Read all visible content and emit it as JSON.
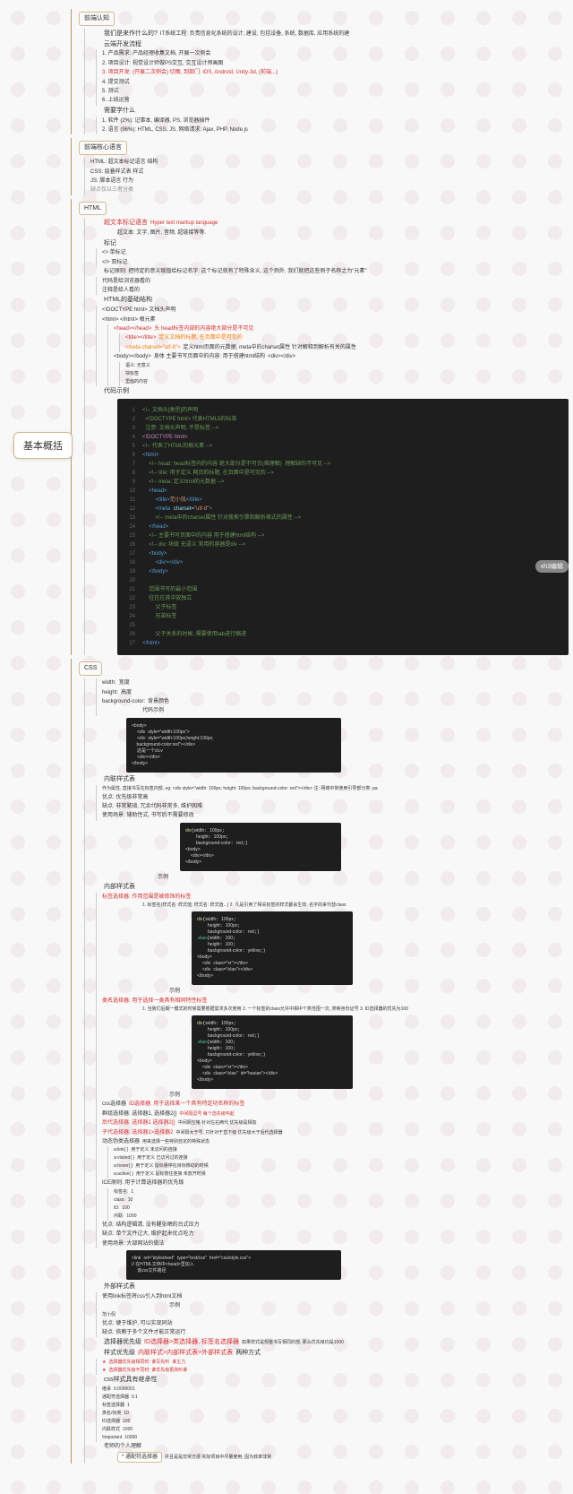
{
  "root": "基本概括",
  "badge": "xh3编辑",
  "s1": {
    "title": "前端认知",
    "q1": "我们是来作什么的?",
    "q1v": "IT系统工程: 负责信息化系统的设计, 建设, 包括设备, 系统, 数据库, 应用系统的建",
    "flow_title": "云端开发流程",
    "flow": [
      "1. 产品需求: 产品经理收集文档, 开展一次例会",
      "2. 项目设计: 视觉设计师做PS交互, 交互设计师画图",
      "3. 项目开发: (开展二次例会) 切图, 到部门: iOS, Android, Unity-3d, (前端...)",
      "4. 提交测试",
      "5. 测试",
      "6. 上线运营"
    ],
    "learn_title": "需要学什么",
    "learn": [
      "1. 软件 (2%): 记事本, 编译器, PS, 浏览器插件",
      "2. 语言 (96%): HTML, CSS, JS, 网络请求: Ajax, PHP, Node.js"
    ]
  },
  "s2": {
    "title": "前端核心语言",
    "items": [
      "HTML: 超文本标记语言    结构",
      "CSS: 层叠样式表    样式",
      "JS: 脚本语言    行为",
      "缺点仅以三者分类"
    ]
  },
  "s3": {
    "title": "HTML",
    "hyper_title": "超文本标记语言",
    "hyper_en": "Hyper text markup language",
    "hyper_desc": "超文本: 文字, 图片, 音频, 超链接等等.",
    "tag_title": "标记",
    "tag_single": "<>    单标记",
    "tag_double": "</>    双标记",
    "tag_rule": "标记原则: 把特定的意义赋值给标记名字: 这个标记就有了特殊含义, 这个例外, 我们就把这些例子名称之为\"元素\"",
    "tag_side1": "代码是给浏览器看的",
    "tag_side2": "注释是给人看的",
    "struct_title": "HTML的基础结构",
    "doctype": "<!DOCTYPE html>    文档头声明",
    "html_tag": "<html> </html>    根元素",
    "head_tag": "<head></head>",
    "head_red": "头    head标签内部的内容绝大部分是不可见",
    "title_tag": "<title></title>",
    "title_desc": "定义文档的标题, 在页面中是可见的",
    "meta_tag": "<meta charset=\"utf-8\">",
    "meta_desc": "定义html页面的元数据, meta中的charset属性 针对解释到解析有关的属性",
    "body_tag": "<body></body>",
    "body_desc": "身体    主要书写页面中的内容: 用于搭建html结构",
    "div_tag": "<div></div>",
    "div_items": [
      "语义: 无意义",
      "块标签",
      "里面的内容"
    ],
    "code_title": "代码示例"
  },
  "code_main": [
    "<!-- 文档头[类型]的声明 -->",
    "<!DOCTYPE html> 代表HTML5的标准",
    "  注意: 文档头声明, 不是标签 -->",
    "<!DOCTYPE html>",
    "<!-- 代表了HTML的根元素 -->",
    "<html>",
    "  <!-- head: head标签内的内容 绝大部分是不可见(难理解)    理解缺的不可见 -->",
    "  <!-- title: 用于定义 网页的标题, 在页面中是可见的 -->",
    "  <!-- meta: 定义html的元数据 -->",
    "  <head>",
    "    <title>范小侃</title>",
    "    <meta charset=\"utf-8\">",
    "    <!-- meta中的charset属性 针对搜索引擎和解析格式的属性 -->",
    "  </head>",
    "  <!-- 主要书写页面中的内容 用于搭建html结构 -->",
    "  <!-- div: 块级 无语义 常用的容器是div -->",
    "  <body>",
    "    <div></div>",
    "  </body>",
    "  范围书写的最小范围",
    "  往往在其中放独立",
    "    父子标签",
    "    兄弟标签",
    "    父子关系的时候, 需要使用tab进行缩进",
    "</html>"
  ],
  "css": {
    "title": "CSS",
    "props": [
      {
        "k": "width:",
        "v": "宽度"
      },
      {
        "k": "height:",
        "v": "高度"
      },
      {
        "k": "background-color:",
        "v": "背景颜色"
      }
    ],
    "inline": {
      "title": "内联样式表",
      "desc": "作为属性, 直接书写在标签内部, eg: <div style=\"width: 100px; height: 100px; background-color: red\"></div>  注: 网络中常使用引导部分类: pa",
      "pros": "优点: 优先级非常高",
      "cons": "缺点: 非常繁琐, 冗余代码非常多, 维护困难",
      "use": "使用场景: 辅助性式, 书写后不需要修改"
    },
    "internal": {
      "title": "内部样式表",
      "sel_title": "css选择器",
      "tag_sel": "标签选择器: 作用范围是被修饰的标签",
      "tag_note": "1. 标签名{样式名: 样式值; 样式名: 样式值...}  2. 凡是引用了相关标签的样式都会生效, 名字的来代替class",
      "class_sel": "类名选择器: 用于选择一类具有相同特性标签",
      "class_note": "1. 当我们后期一模式的时候需要根据需求多次使用  2. 一个标签的class允许中相中个类范围一次, 类映身份证号  3. ID选择器的优先为100",
      "id_sel": "ID选择器: 用于选择某一个具有特定功名称的标签",
      "group_sel": "群组选择器: 选择器1, 选择器2{}",
      "group_note": "中间隔逗号  每个选先级叫起",
      "desc_sel": "后代选择器: 选择器1 选择器2{}",
      "desc_note": "中间隔空格 针对左右两代  优先级是相加",
      "child_sel": "子代选择器: 选择器1>选择器2",
      "child_note": "中间隔大于号, 只针对于直下级  优先级大于后代选择器",
      "pseudo_title": "动态伪类选择器",
      "pseudo_desc": "用来选择一些特别自定的特殊状态",
      "pseudos": [
        {
          "k": "a:link{ }",
          "v": "用于定义 未访问的连接"
        },
        {
          "k": "a:visited{ }",
          "v": "用于定义 已访问过的连接"
        },
        {
          "k": "a:hover{ }",
          "v": "用于定义 鼠标悬停在目标移动的时候"
        },
        {
          "k": "a:active{ }",
          "v": "用于定义 鼠标按住连接 未放开时候"
        }
      ],
      "ice_title": "ICE原则: 用于计算选择器的优先级",
      "ice": [
        {
          "k": "标签名:",
          "v": "1"
        },
        {
          "k": "class:",
          "v": "10"
        },
        {
          "k": "ID:",
          "v": "100"
        },
        {
          "k": "内联:",
          "v": "1000"
        }
      ],
      "int_pros": "优点: 结构逻辑清, 没有醒张晒的台式压力",
      "int_cons": "缺点: 单个文件过大, 维护起来优点吃力",
      "int_use": "使用场景: 大部网站的做法"
    },
    "external": {
      "title": "外部样式表",
      "link": "使用link标签将css引入到html文档",
      "link_code": "<link rel=\"stylesheet\" type=\"text/css\" href=\"css/style.css\">",
      "exam": "范小侃",
      "pros": "优点: 便于维护, 可以实现同站",
      "cons": "缺点: 依赖于多个文件才能正常运行"
    },
    "priority": {
      "title": "选择器优先级",
      "rule": "ID选择器>类选择器, 标签名选择器",
      "note": "如果样式是规整书写相同的部, 那么优先级均是1000",
      "conflict_title": "样式优先级",
      "conflict": "内联样式>内部样式表>外部样式表",
      "both": "两种方式",
      "r1": "选择器优先级相同时: 谁写先听",
      "r2": "谁主力",
      "r3": "选择器优先级不同时: 谁优先级更高听谁"
    },
    "csspriority": {
      "title": "css样式具有继承性",
      "items": [
        {
          "k": "继承",
          "v": "0.0000001"
        },
        {
          "k": "通配符选择器",
          "v": "0.1"
        },
        {
          "k": "标签选择器",
          "v": "1"
        },
        {
          "k": "类名/伪类",
          "v": "10"
        },
        {
          "k": "ID选择器",
          "v": "100"
        },
        {
          "k": "内联样式",
          "v": "1000"
        },
        {
          "k": "!important",
          "v": "10000"
        }
      ]
    },
    "personal": "老师的个人理解",
    "wildcard": "* 通配符选择器",
    "wildcard_desc": "并且是是非常方便 实际项目中尽量使用, 因为效率非常"
  },
  "code2": "div{\n    width: 100px;\n    height: 100px;\n    background-color: red;\n}\n<body>\n    <div style=\"width:100px\"></div>\n    这是一个div\n    <div></div>\n</body>",
  "code3": "div{width: 100px;\n    height: 100px;\n    background-color: red;}\n.elao{width: 100;\n    height: 100;\n    background-color: yellow;}\n</style>\n<body>\n  <div class=\"xr\"></div>\n  <div class=\"elao\"></div>\n</body>",
  "code4": "div{width: 100px;\n    height: 100px;\n    background-color: red;}\n.elao{width: 100;\n    height: 100;\n    background-color: yellow;}\n</style>\n<body>\n  <div class=\"xr\"></div>\n  <div class=\"elao\" id=\"haxian\"></div>\n</body>"
}
